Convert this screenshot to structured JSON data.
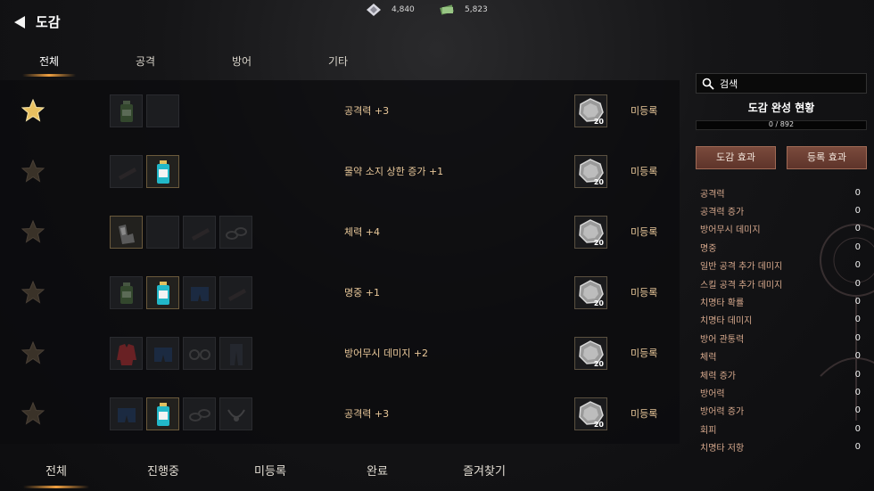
{
  "header": {
    "title": "도감",
    "currencies": [
      {
        "icon": "crystal-icon",
        "value": "4,840"
      },
      {
        "icon": "cash-icon",
        "value": "5,823"
      }
    ]
  },
  "tabs": [
    {
      "label": "전체",
      "active": true
    },
    {
      "label": "공격",
      "active": false
    },
    {
      "label": "방어",
      "active": false
    },
    {
      "label": "기타",
      "active": false
    }
  ],
  "rows": [
    {
      "favorite": true,
      "slots": [
        {
          "item": "potion-green",
          "owned": false
        },
        {
          "item": "empty",
          "owned": false
        }
      ],
      "effect": "공격력 +3",
      "reward_count": "20",
      "status": "미등록"
    },
    {
      "favorite": false,
      "slots": [
        {
          "item": "item-faded",
          "owned": false
        },
        {
          "item": "potion-cyan",
          "owned": true
        }
      ],
      "effect": "물약 소지 상한 증가 +1",
      "reward_count": "20",
      "status": "미등록"
    },
    {
      "favorite": false,
      "slots": [
        {
          "item": "gloves",
          "owned": true
        },
        {
          "item": "empty",
          "owned": false
        },
        {
          "item": "item-faded",
          "owned": false
        },
        {
          "item": "chain",
          "owned": false
        }
      ],
      "effect": "체력 +4",
      "reward_count": "20",
      "status": "미등록"
    },
    {
      "favorite": false,
      "slots": [
        {
          "item": "potion-green",
          "owned": false
        },
        {
          "item": "potion-cyan",
          "owned": true
        },
        {
          "item": "shorts-blue",
          "owned": false
        },
        {
          "item": "item-faded",
          "owned": false
        }
      ],
      "effect": "명중 +1",
      "reward_count": "20",
      "status": "미등록"
    },
    {
      "favorite": false,
      "slots": [
        {
          "item": "jacket-red",
          "owned": false
        },
        {
          "item": "shorts-blue",
          "owned": false
        },
        {
          "item": "glasses",
          "owned": false
        },
        {
          "item": "pants",
          "owned": false
        }
      ],
      "effect": "방어무시 데미지 +2",
      "reward_count": "20",
      "status": "미등록"
    },
    {
      "favorite": false,
      "slots": [
        {
          "item": "shorts-blue",
          "owned": false
        },
        {
          "item": "potion-cyan",
          "owned": true
        },
        {
          "item": "chain",
          "owned": false
        },
        {
          "item": "necklace",
          "owned": false
        }
      ],
      "effect": "공격력 +3",
      "reward_count": "20",
      "status": "미등록"
    }
  ],
  "bottom_tabs": [
    {
      "label": "전체",
      "active": true
    },
    {
      "label": "진행중",
      "active": false
    },
    {
      "label": "미등록",
      "active": false
    },
    {
      "label": "완료",
      "active": false
    },
    {
      "label": "즐겨찾기",
      "active": false
    }
  ],
  "sidebar": {
    "search_label": "검색",
    "title": "도감 완성 현황",
    "progress_text": "0 / 892",
    "progress_fraction": 0,
    "btn_effect": "도감 효과",
    "btn_register": "등록 효과",
    "stats": [
      {
        "label": "공격력",
        "value": "0"
      },
      {
        "label": "공격력 증가",
        "value": "0"
      },
      {
        "label": "방어무시 데미지",
        "value": "0"
      },
      {
        "label": "명중",
        "value": "0"
      },
      {
        "label": "일반 공격 추가 데미지",
        "value": "0"
      },
      {
        "label": "스킬 공격 추가 데미지",
        "value": "0"
      },
      {
        "label": "치명타 확률",
        "value": "0"
      },
      {
        "label": "치명타 데미지",
        "value": "0"
      },
      {
        "label": "방어 관통력",
        "value": "0"
      },
      {
        "label": "체력",
        "value": "0"
      },
      {
        "label": "체력 증가",
        "value": "0"
      },
      {
        "label": "방어력",
        "value": "0"
      },
      {
        "label": "방어력 증가",
        "value": "0"
      },
      {
        "label": "회피",
        "value": "0"
      },
      {
        "label": "치명타 저항",
        "value": "0"
      }
    ]
  }
}
